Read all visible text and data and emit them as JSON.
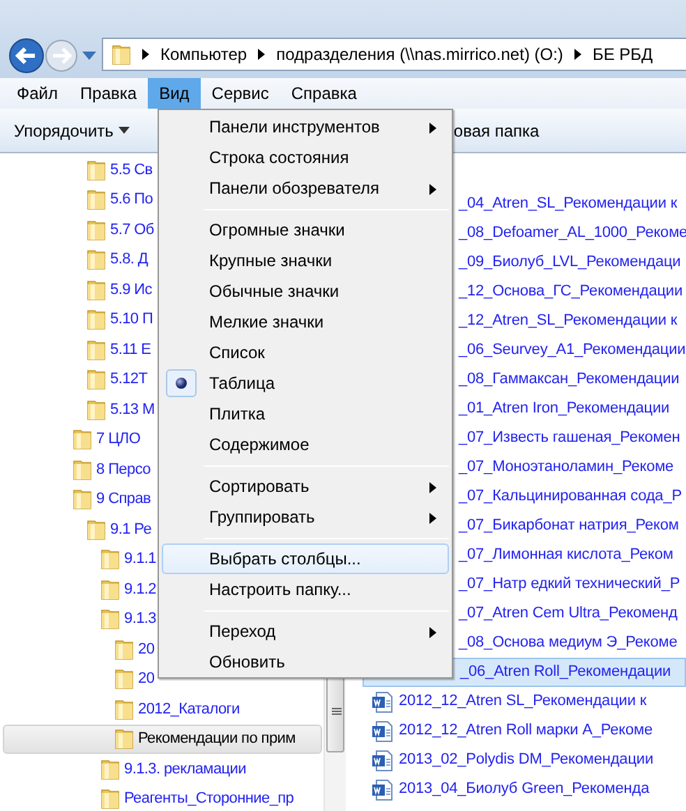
{
  "address_bar": {
    "segments": [
      "Компьютер",
      "подразделения (\\\\nas.mirrico.net) (O:)",
      "БЕ РБД"
    ]
  },
  "menu_bar": [
    {
      "label": "Файл",
      "selected": false
    },
    {
      "label": "Правка",
      "selected": false
    },
    {
      "label": "Вид",
      "selected": true
    },
    {
      "label": "Сервис",
      "selected": false
    },
    {
      "label": "Справка",
      "selected": false
    }
  ],
  "toolbar": {
    "organize": "Упорядочить",
    "new_folder": "овая папка"
  },
  "tree": [
    {
      "children": [
        {
          "label": "5.5 Св",
          "selected": false,
          "compressed": true
        },
        {
          "label": "5.6 По",
          "selected": false,
          "compressed": true
        },
        {
          "label": "5.7 Об",
          "selected": false,
          "compressed": true
        },
        {
          "label": "5.8. Д",
          "selected": false,
          "compressed": true
        },
        {
          "label": "5.9 Ис",
          "selected": false,
          "compressed": true
        },
        {
          "label": "5.10 П",
          "selected": false,
          "compressed": true
        },
        {
          "label": "5.11 Е",
          "selected": false,
          "compressed": true
        },
        {
          "label": "5.12Т",
          "selected": false,
          "compressed": true
        },
        {
          "label": "5.13 М",
          "selected": false,
          "compressed": true
        }
      ]
    },
    {
      "label": "7 ЦЛО",
      "selected": false,
      "compressed": true
    },
    {
      "label": "8 Персо",
      "selected": false,
      "compressed": true
    },
    {
      "label": "9 Справ",
      "selected": false,
      "compressed": true,
      "children": [
        {
          "label": "9.1 Ре",
          "selected": false,
          "compressed": true,
          "children": [
            {
              "label": "9.1.1",
              "selected": false,
              "compressed": true
            },
            {
              "label": "9.1.2",
              "selected": false,
              "compressed": true
            },
            {
              "label": "9.1.3",
              "selected": false,
              "compressed": true,
              "children": [
                {
                  "label": "20",
                  "selected": false,
                  "compressed": true
                },
                {
                  "label": "20",
                  "selected": false,
                  "compressed": true
                },
                {
                  "label": "2012_Каталоги",
                  "selected": false,
                  "compressed": true
                },
                {
                  "label": "Рекомендации по прим",
                  "selected": true,
                  "compressed": false
                }
              ]
            },
            {
              "label": "9.1.3. рекламации",
              "selected": false,
              "compressed": true
            },
            {
              "label": "Реагенты_Сторонние_пр",
              "selected": false,
              "compressed": true
            }
          ]
        }
      ]
    }
  ],
  "files": [
    {
      "kind": "covered",
      "name": "_04_Atren_SL_Рекомендации к",
      "selected": false
    },
    {
      "kind": "covered",
      "name": "_08_Defoamer_AL_1000_Рекоме",
      "selected": false
    },
    {
      "kind": "covered",
      "name": "_09_Биолуб_LVL_Рекомендаци",
      "selected": false
    },
    {
      "kind": "covered",
      "name": "_12_Основа_ГС_Рекомендации",
      "selected": false
    },
    {
      "kind": "covered",
      "name": "_12_Atren_SL_Рекомендации к",
      "selected": false
    },
    {
      "kind": "covered",
      "name": "_06_Seurvey_A1_Рекомендации",
      "selected": false
    },
    {
      "kind": "covered",
      "name": "_08_Гаммаксан_Рекомендации",
      "selected": false
    },
    {
      "kind": "covered",
      "name": "_01_Atren Iron_Рекомендации",
      "selected": false
    },
    {
      "kind": "covered",
      "name": "_07_Известь гашеная_Рекомен",
      "selected": false
    },
    {
      "kind": "covered",
      "name": "_07_Моноэтаноламин_Рекоме",
      "selected": false
    },
    {
      "kind": "covered",
      "name": "_07_Кальцинированная сода_Р",
      "selected": false
    },
    {
      "kind": "covered",
      "name": "_07_Бикарбонат натрия_Реком",
      "selected": false
    },
    {
      "kind": "covered",
      "name": "_07_Лимонная кислота_Реком",
      "selected": false
    },
    {
      "kind": "covered",
      "name": "_07_Натр едкий технический_Р",
      "selected": false
    },
    {
      "kind": "covered",
      "name": "_07_Atren Cem Ultra_Рекоменд",
      "selected": false
    },
    {
      "kind": "covered",
      "name": "_08_Основа медиум Э_Рекоме",
      "selected": false
    },
    {
      "kind": "covered",
      "name": "_06_Atren Roll_Рекомендации",
      "selected": true
    },
    {
      "kind": "document",
      "name": "2012_12_Atren SL_Рекомендации к",
      "selected": false
    },
    {
      "kind": "document",
      "name": "2012_12_Atren Roll марки А_Рекоме",
      "selected": false
    },
    {
      "kind": "document",
      "name": "2013_02_Polydis DM_Рекомендации",
      "selected": false
    },
    {
      "kind": "document",
      "name": "2013_04_Биолуб Green_Рекоменда",
      "selected": false
    }
  ],
  "view_menu": [
    {
      "kind": "item",
      "label": "Панели инструментов",
      "submenu": true,
      "checked": false,
      "highlighted": false
    },
    {
      "kind": "item",
      "label": "Строка состояния",
      "submenu": false,
      "checked": false,
      "highlighted": false
    },
    {
      "kind": "item",
      "label": "Панели обозревателя",
      "submenu": true,
      "checked": false,
      "highlighted": false
    },
    {
      "kind": "separator"
    },
    {
      "kind": "item",
      "label": "Огромные значки",
      "submenu": false,
      "checked": false,
      "highlighted": false
    },
    {
      "kind": "item",
      "label": "Крупные значки",
      "submenu": false,
      "checked": false,
      "highlighted": false
    },
    {
      "kind": "item",
      "label": "Обычные значки",
      "submenu": false,
      "checked": false,
      "highlighted": false
    },
    {
      "kind": "item",
      "label": "Мелкие значки",
      "submenu": false,
      "checked": false,
      "highlighted": false
    },
    {
      "kind": "item",
      "label": "Список",
      "submenu": false,
      "checked": false,
      "highlighted": false
    },
    {
      "kind": "item",
      "label": "Таблица",
      "submenu": false,
      "checked": true,
      "highlighted": false
    },
    {
      "kind": "item",
      "label": "Плитка",
      "submenu": false,
      "checked": false,
      "highlighted": false
    },
    {
      "kind": "item",
      "label": "Содержимое",
      "submenu": false,
      "checked": false,
      "highlighted": false
    },
    {
      "kind": "separator"
    },
    {
      "kind": "item",
      "label": "Сортировать",
      "submenu": true,
      "checked": false,
      "highlighted": false
    },
    {
      "kind": "item",
      "label": "Группировать",
      "submenu": true,
      "checked": false,
      "highlighted": false
    },
    {
      "kind": "separator"
    },
    {
      "kind": "item",
      "label": "Выбрать столбцы...",
      "submenu": false,
      "checked": false,
      "highlighted": true
    },
    {
      "kind": "item",
      "label": "Настроить папку...",
      "submenu": false,
      "checked": false,
      "highlighted": false
    },
    {
      "kind": "separator"
    },
    {
      "kind": "item",
      "label": "Переход",
      "submenu": true,
      "checked": false,
      "highlighted": false
    },
    {
      "kind": "item",
      "label": "Обновить",
      "submenu": false,
      "checked": false,
      "highlighted": false
    }
  ]
}
